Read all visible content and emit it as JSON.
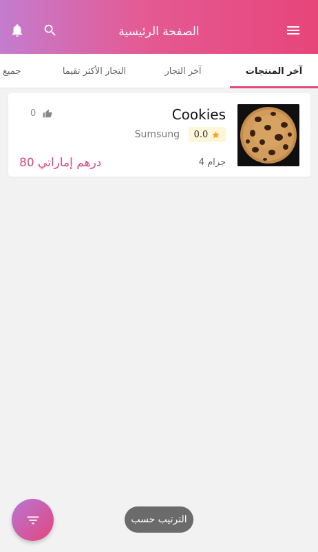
{
  "header": {
    "title": "الصفحة الرئيسية",
    "icons": [
      "notification-icon",
      "search-icon",
      "menu-icon"
    ]
  },
  "tabs": [
    {
      "label": "آخر المنتجات",
      "active": true
    },
    {
      "label": "آخر التجار",
      "active": false
    },
    {
      "label": "التجار الأكثر تقيما",
      "active": false
    },
    {
      "label": "جميع",
      "active": false
    }
  ],
  "product": {
    "name": "Cookies",
    "likes": "0",
    "merchant": "Sumsung",
    "rating": "0.0",
    "price": "80 درهم إماراتي",
    "weight": "4 جرام"
  },
  "sort": {
    "label": "الترتيب حسب"
  },
  "colors": {
    "accent": "#e0457b",
    "header_start": "#c47ccf",
    "header_end": "#e7457a",
    "star": "#f5a623"
  }
}
